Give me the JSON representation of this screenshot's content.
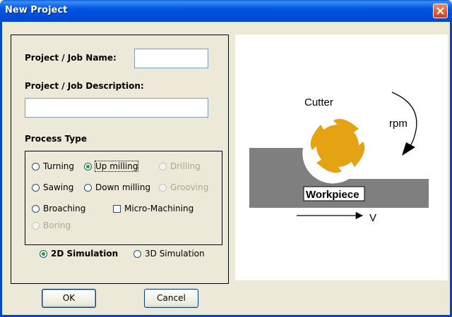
{
  "window": {
    "title": "New Project"
  },
  "form": {
    "name_label": "Project / Job Name:",
    "name_value": "",
    "description_label": "Project / Job Description:",
    "description_value": "",
    "process_type_label": "Process Type"
  },
  "process_options": {
    "turning": "Turning",
    "up_milling": "Up milling",
    "drilling": "Drilling",
    "sawing": "Sawing",
    "down_milling": "Down milling",
    "grooving": "Grooving",
    "broaching": "Broaching",
    "micro_machining": "Micro-Machining",
    "boring": "Boring",
    "selected": "Up milling"
  },
  "simulation": {
    "sim2d": "2D Simulation",
    "sim3d": "3D Simulation",
    "selected": "2D Simulation"
  },
  "buttons": {
    "ok": "OK",
    "cancel": "Cancel"
  },
  "diagram": {
    "cutter_label": "Cutter",
    "rpm_label": "rpm",
    "workpiece_label": "Workpiece",
    "velocity_label": "V",
    "colors": {
      "cutter": "#e5a313",
      "workpiece": "#7f7f7f"
    }
  }
}
